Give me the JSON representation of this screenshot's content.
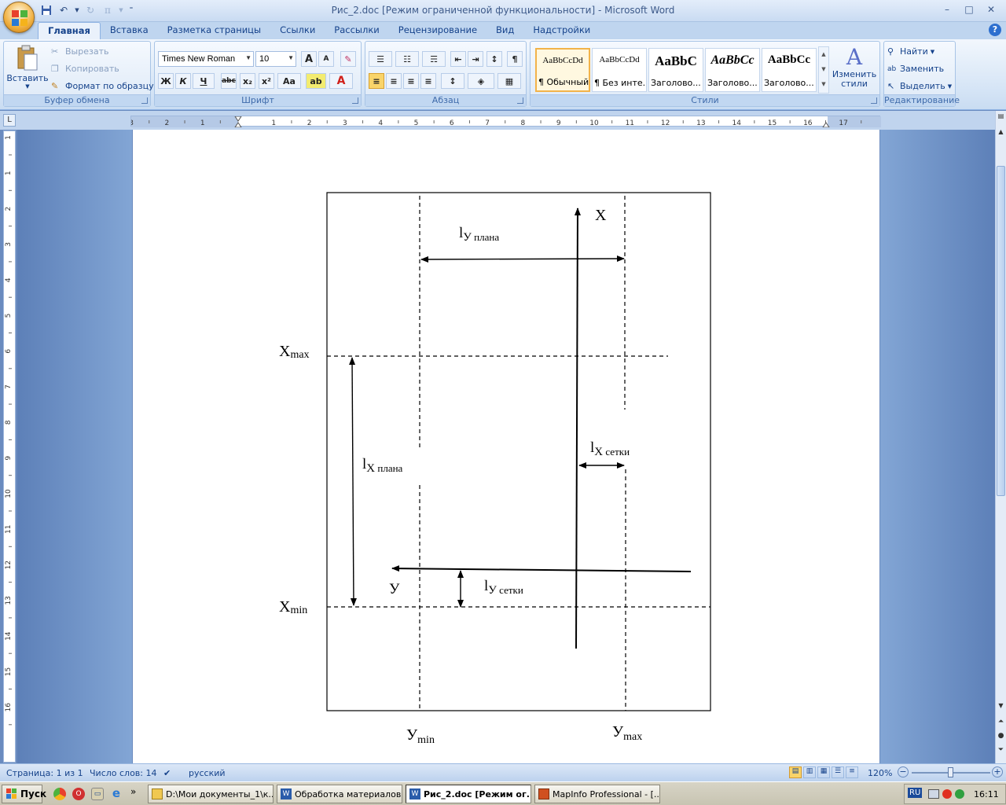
{
  "window": {
    "title": "Рис_2.doc [Режим ограниченной функциональности] - Microsoft Word",
    "minimize": "–",
    "maximize": "□",
    "close": "✕"
  },
  "quick_access": {
    "pi": "π"
  },
  "tabs": [
    "Главная",
    "Вставка",
    "Разметка страницы",
    "Ссылки",
    "Рассылки",
    "Рецензирование",
    "Вид",
    "Надстройки"
  ],
  "help": "?",
  "clipboard": {
    "paste": "Вставить",
    "cut": "Вырезать",
    "copy": "Копировать",
    "format_painter": "Формат по образцу",
    "label": "Буфер обмена"
  },
  "font": {
    "name": "Times New Roman",
    "size": "10",
    "bold": "Ж",
    "italic": "К",
    "underline": "Ч",
    "strike": "abc",
    "sub": "x₂",
    "sup": "x²",
    "case": "Aa",
    "grow": "A",
    "shrink": "A",
    "label": "Шрифт"
  },
  "paragraph": {
    "label": "Абзац",
    "pilcrow": "¶"
  },
  "styles": {
    "items": [
      {
        "sample": "AaBbCcDd",
        "name": "¶ Обычный"
      },
      {
        "sample": "AaBbCcDd",
        "name": "¶ Без инте..."
      },
      {
        "sample": "AaBbC",
        "name": "Заголово..."
      },
      {
        "sample": "AaBbCc",
        "name": "Заголово..."
      },
      {
        "sample": "AaBbCc",
        "name": "Заголово..."
      }
    ],
    "change": "Изменить стили",
    "label": "Стили"
  },
  "editing": {
    "find": "Найти",
    "replace": "Заменить",
    "select": "Выделить",
    "label": "Редактирование"
  },
  "ruler": {
    "h_ticks": [
      "3",
      "2",
      "1",
      "1",
      "2",
      "3",
      "4",
      "5",
      "6",
      "7",
      "8",
      "9",
      "10",
      "11",
      "12",
      "13",
      "14",
      "15",
      "16",
      "17"
    ],
    "v_ticks": [
      "1",
      "1",
      "2",
      "3",
      "4",
      "5",
      "6",
      "7",
      "8",
      "9",
      "10",
      "11",
      "12",
      "13",
      "14",
      "15",
      "16"
    ]
  },
  "diagram": {
    "x_axis": "X",
    "y_axis": "У",
    "ly_plan": {
      "main": "l",
      "sub1": "У",
      "sub2": " плана"
    },
    "lx_plan": {
      "main": "l",
      "sub1": "X",
      "sub2": " плана"
    },
    "lx_grid": {
      "main": "l",
      "sub1": "X",
      "sub2": " сетки"
    },
    "ly_grid": {
      "main": "l",
      "sub1": "У",
      "sub2": " сетки"
    },
    "xmax": {
      "main": "X",
      "sub": "max"
    },
    "xmin": {
      "main": "X",
      "sub": "min"
    },
    "ymin": {
      "main": "У",
      "sub": "min"
    },
    "ymax": {
      "main": "У",
      "sub": "max"
    }
  },
  "status": {
    "page": "Страница: 1 из 1",
    "words": "Число слов: 14",
    "lang": "русский",
    "zoom": "120%"
  },
  "taskbar": {
    "start": "Пуск",
    "more": "»",
    "tasks": [
      "D:\\Мои документы_1\\к...",
      "Обработка материалов...",
      "Рис_2.doc [Режим ог...",
      "MapInfo Professional - [..."
    ],
    "tray_lang": "RU",
    "clock": "16:11"
  }
}
